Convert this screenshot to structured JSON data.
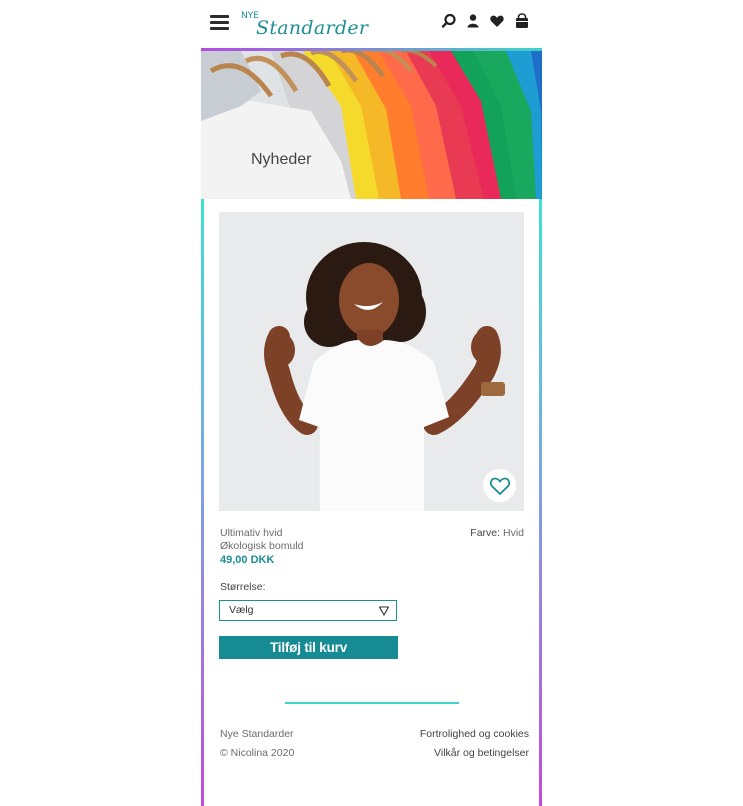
{
  "header": {
    "logo_small": "NYE",
    "logo_big": "Standarder",
    "icons": [
      "menu-icon",
      "search-icon",
      "user-icon",
      "heart-icon",
      "bag-icon"
    ]
  },
  "hero": {
    "title": "Nyheder"
  },
  "product": {
    "name_line1": "Ultimativ hvid",
    "name_line2": "Økologisk bomuld",
    "price": "49,00 DKK",
    "color_label": "Farve:",
    "color_value": "Hvid",
    "size_label": "Størrelse:",
    "size_selected": "Vælg",
    "add_button": "Tilføj til kurv"
  },
  "footer": {
    "brand": "Nye Standarder",
    "copyright": "© Nicolina 2020",
    "privacy_link": "Fortrolighed og cookies",
    "terms_link": "Vilkår og betingelser"
  },
  "colors": {
    "accent": "#1d8f94",
    "button": "#178b93",
    "gradient_start": "#3fe0cf",
    "gradient_end": "#c34ae0"
  }
}
